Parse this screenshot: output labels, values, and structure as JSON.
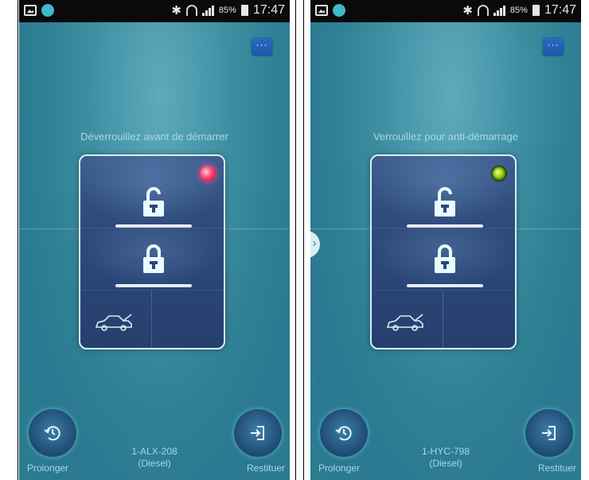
{
  "screens": [
    {
      "status": {
        "battery": "85%",
        "time": "17:47"
      },
      "hint": "Déverrouillez avant de démarrer",
      "led": "red",
      "plate": "1-ALX-208",
      "fuel": "(Diesel)",
      "extend_label": "Prolonger",
      "return_label": "Restituer",
      "more_label": "···"
    },
    {
      "status": {
        "battery": "85%",
        "time": "17:47"
      },
      "hint": "Verrouillez pour anti-démarrage",
      "led": "green",
      "plate": "1-HYC-798",
      "fuel": "(Diesel)",
      "extend_label": "Prolonger",
      "return_label": "Restituer",
      "more_label": "···",
      "side_arrow": "›"
    }
  ],
  "colors": {
    "background": "#2f7f94",
    "led_red": "#ff4f7a",
    "led_green": "#a6e11d",
    "keyfob": "#2e4c7c"
  },
  "icons": [
    "image-notification-icon",
    "app-dot-icon",
    "bluetooth-icon",
    "wifi-icon",
    "signal-icon",
    "battery-icon",
    "unlock-icon",
    "lock-icon",
    "trunk-icon",
    "clock-extend-icon",
    "return-icon"
  ]
}
